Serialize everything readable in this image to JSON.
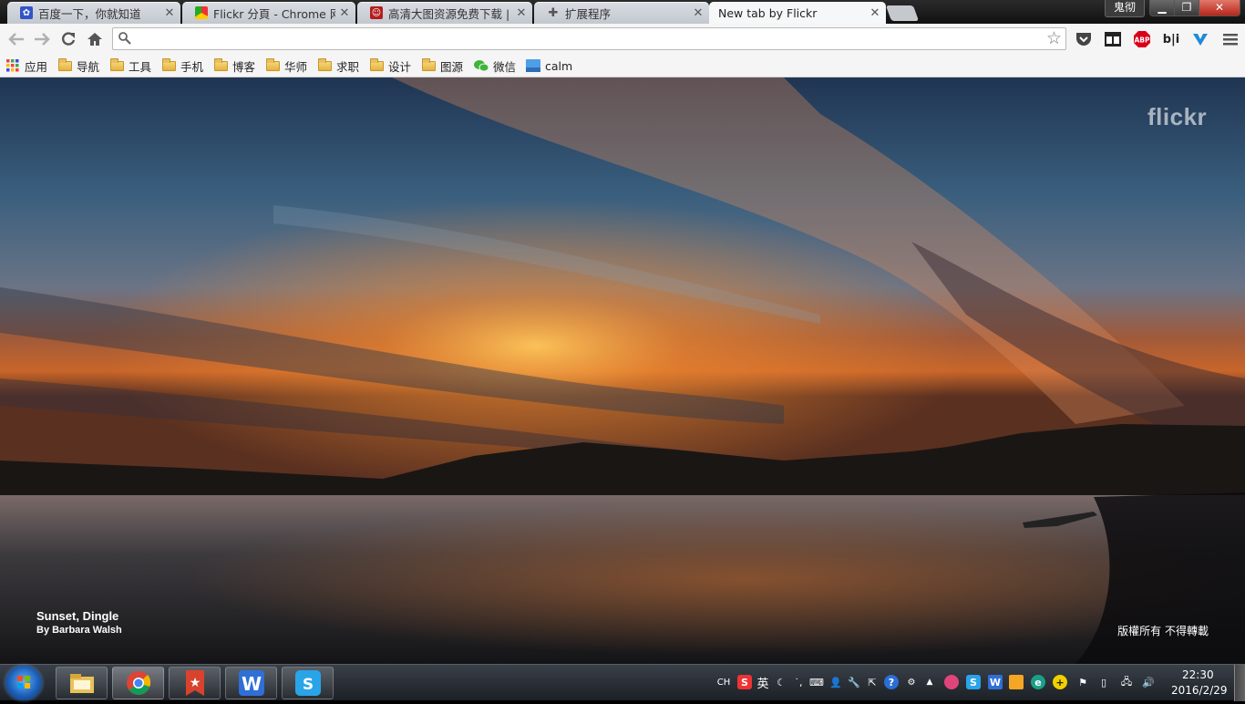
{
  "tabs": [
    {
      "title": "百度一下，你就知道",
      "favicon": "baidu-paw-icon"
    },
    {
      "title": "Flickr 分頁 - Chrome 网上",
      "favicon": "chrome-webstore-icon"
    },
    {
      "title": "高清大图资源免费下载 | B",
      "favicon": "red-site-icon"
    },
    {
      "title": "扩展程序",
      "favicon": "puzzle-piece-icon"
    },
    {
      "title": "New tab by Flickr",
      "favicon": ""
    }
  ],
  "window": {
    "user": "鬼彻"
  },
  "omnibox": {
    "value": "",
    "placeholder": ""
  },
  "extensions": [
    "pocket-icon",
    "panda-icon",
    "adblock-plus-icon",
    "bilibili-icon",
    "vimium-icon",
    "chrome-menu-icon"
  ],
  "bookmarks": [
    {
      "label": "应用",
      "icon": "apps-grid-icon"
    },
    {
      "label": "导航",
      "icon": "folder-icon"
    },
    {
      "label": "工具",
      "icon": "folder-icon"
    },
    {
      "label": "手机",
      "icon": "folder-icon"
    },
    {
      "label": "博客",
      "icon": "folder-icon"
    },
    {
      "label": "华师",
      "icon": "folder-icon"
    },
    {
      "label": "求职",
      "icon": "folder-icon"
    },
    {
      "label": "设计",
      "icon": "folder-icon"
    },
    {
      "label": "图源",
      "icon": "folder-icon"
    },
    {
      "label": "微信",
      "icon": "wechat-icon"
    },
    {
      "label": "calm",
      "icon": "calm-icon"
    }
  ],
  "content": {
    "logo": "flickr",
    "photo_title": "Sunset, Dingle",
    "photo_author": "By Barbara Walsh",
    "copyright": "版權所有 不得轉載"
  },
  "taskbar": {
    "apps": [
      "file-explorer-icon",
      "chrome-icon",
      "wunderlist-icon",
      "wps-writer-icon",
      "sogou-app-icon"
    ],
    "tray_lang": "CH",
    "tray_ime": "英",
    "clock_time": "22:30",
    "clock_date": "2016/2/29"
  },
  "colors": {
    "flickr_logo": "#ffffff",
    "close_button": "#c7392a",
    "start_orb": "#1d5fb7"
  }
}
